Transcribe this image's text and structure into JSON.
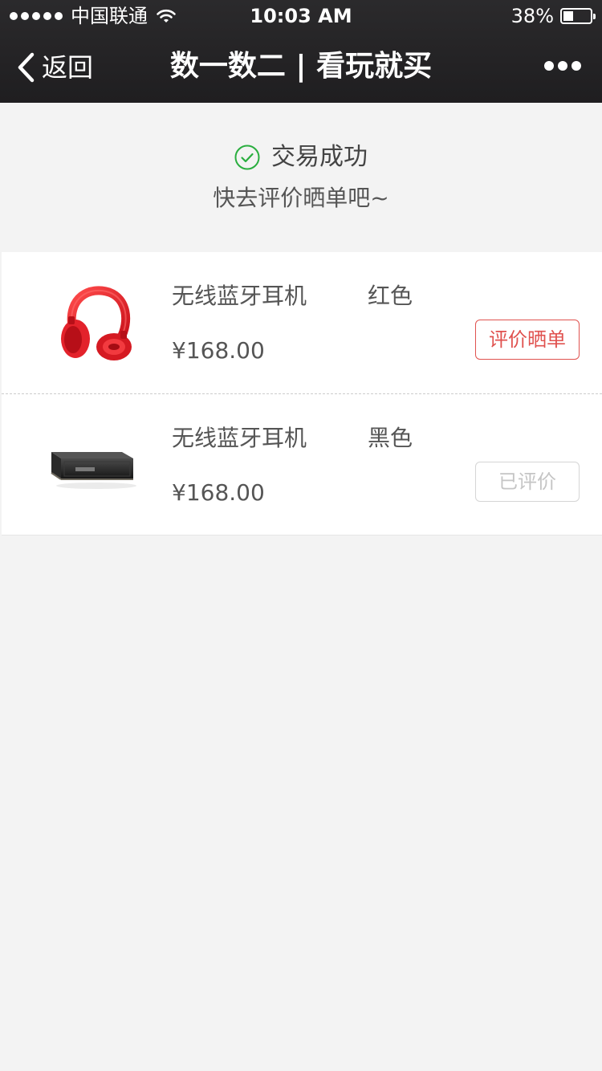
{
  "status_bar": {
    "carrier": "中国联通",
    "time": "10:03 AM",
    "battery": "38%",
    "battery_level": 0.38
  },
  "nav": {
    "back_label": "返回",
    "title": "数一数二 | 看玩就买"
  },
  "result": {
    "status_text": "交易成功",
    "sub_text": "快去评价晒单吧~",
    "accent_color": "#2aae3f"
  },
  "orders": [
    {
      "name": "无线蓝牙耳机",
      "color": "红色",
      "price": "¥168.00",
      "action_label": "评价晒单",
      "action_state": "pending",
      "image": "red-headphones-icon"
    },
    {
      "name": "无线蓝牙耳机",
      "color": "黑色",
      "price": "¥168.00",
      "action_label": "已评价",
      "action_state": "done",
      "image": "black-speaker-icon"
    }
  ],
  "colors": {
    "nav_bg": "#252426",
    "page_bg": "#f3f3f3",
    "action_red": "#e0524f",
    "disabled_gray": "#c5c5c5"
  }
}
